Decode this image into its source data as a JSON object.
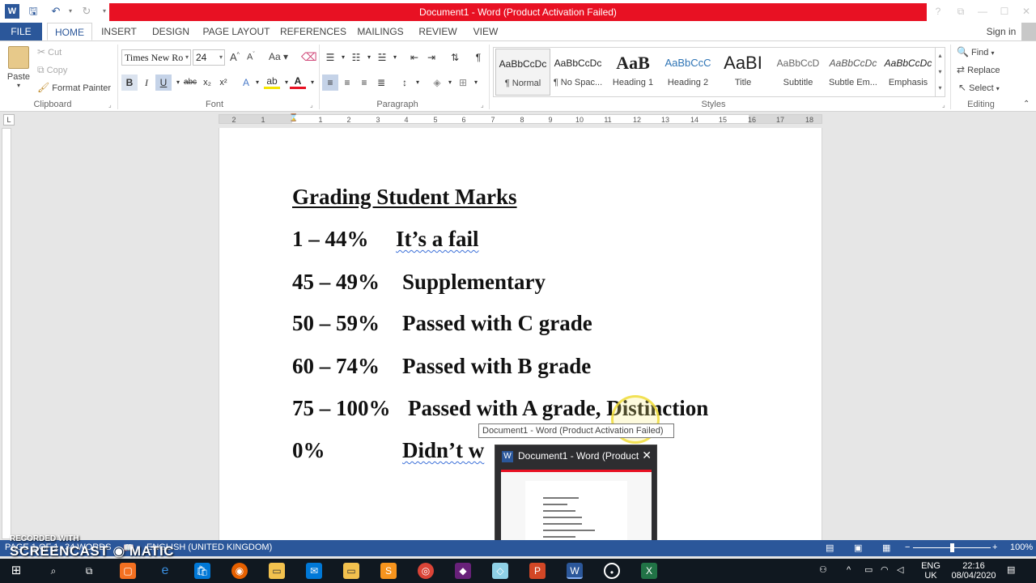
{
  "window": {
    "title": "Document1 - Word (Product Activation Failed)",
    "sign_in": "Sign in"
  },
  "tabs": [
    "FILE",
    "HOME",
    "INSERT",
    "DESIGN",
    "PAGE LAYOUT",
    "REFERENCES",
    "MAILINGS",
    "REVIEW",
    "VIEW"
  ],
  "active_tab": "HOME",
  "clipboard": {
    "paste": "Paste",
    "cut": "Cut",
    "copy": "Copy",
    "format_painter": "Format Painter",
    "label": "Clipboard"
  },
  "font": {
    "name": "Times New Ro",
    "size": "24",
    "label": "Font"
  },
  "paragraph": {
    "label": "Paragraph"
  },
  "styles": {
    "label": "Styles",
    "items": [
      {
        "sample": "AaBbCcDc",
        "name": "¶ Normal"
      },
      {
        "sample": "AaBbCcDc",
        "name": "¶ No Spac..."
      },
      {
        "sample": "AaB",
        "name": "Heading 1"
      },
      {
        "sample": "AaBbCcC",
        "name": "Heading 2"
      },
      {
        "sample": "AaBI",
        "name": "Title"
      },
      {
        "sample": "AaBbCcD",
        "name": "Subtitle"
      },
      {
        "sample": "AaBbCcDc",
        "name": "Subtle Em..."
      },
      {
        "sample": "AaBbCcDc",
        "name": "Emphasis"
      }
    ]
  },
  "editing": {
    "find": "Find",
    "replace": "Replace",
    "select": "Select",
    "label": "Editing"
  },
  "ruler": [
    "2",
    "1",
    "1",
    "2",
    "3",
    "4",
    "5",
    "6",
    "7",
    "8",
    "9",
    "10",
    "11",
    "12",
    "13",
    "14",
    "15",
    "16",
    "17",
    "18"
  ],
  "document": {
    "title": "Grading Student Marks",
    "lines": [
      {
        "range": "1 – 44%",
        "text": "It’s a fail"
      },
      {
        "range": "45 – 49%",
        "text": "Supplementary"
      },
      {
        "range": "50 – 59%",
        "text": "Passed with C grade"
      },
      {
        "range": "60 – 74%",
        "text": "Passed with B grade"
      },
      {
        "range": "75 – 100%",
        "text": "Passed with A grade, Distinction"
      },
      {
        "range": "0%",
        "text": "Didn’t w"
      }
    ]
  },
  "taskbar_preview": {
    "tooltip": "Document1 - Word (Product Activation Failed)",
    "title": "Document1 - Word (Product Activation Failed)"
  },
  "status": {
    "page": "PAGE 1 OF 1",
    "words": "34 WORDS",
    "language": "ENGLISH (UNITED KINGDOM)",
    "zoom": "100%"
  },
  "watermark": {
    "line1": "RECORDED WITH",
    "line2": "SCREENCAST ◉ MATIC"
  },
  "tray": {
    "lang": "ENG",
    "region": "UK",
    "time": "22:16",
    "date": "08/04/2020"
  },
  "colors": {
    "word_blue": "#2b579a",
    "title_red": "#e81123"
  }
}
